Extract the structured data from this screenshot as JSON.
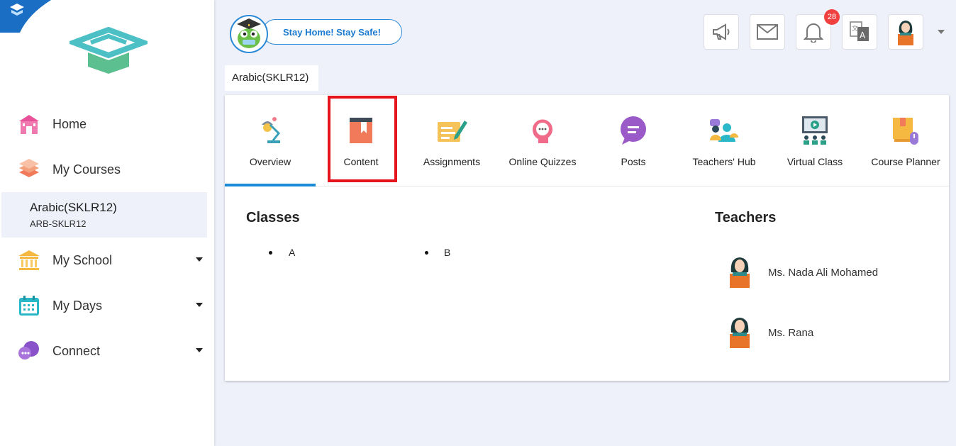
{
  "header": {
    "banner_text": "Stay Home! Stay Safe!",
    "notification_count": "28"
  },
  "sidebar": {
    "items": [
      {
        "label": "Home",
        "icon": "home-icon"
      },
      {
        "label": "My Courses",
        "icon": "courses-icon"
      },
      {
        "label": "My School",
        "icon": "school-icon"
      },
      {
        "label": "My Days",
        "icon": "calendar-icon"
      },
      {
        "label": "Connect",
        "icon": "connect-icon"
      }
    ],
    "active_course": {
      "title": "Arabic(SKLR12)",
      "code": "ARB-SKLR12"
    }
  },
  "course_chip": "Arabic(SKLR12)",
  "tabs": [
    {
      "label": "Overview",
      "icon": "lamp-icon"
    },
    {
      "label": "Content",
      "icon": "book-icon"
    },
    {
      "label": "Assignments",
      "icon": "assignment-icon"
    },
    {
      "label": "Online Quizzes",
      "icon": "quiz-icon"
    },
    {
      "label": "Posts",
      "icon": "chat-icon"
    },
    {
      "label": "Teachers' Hub",
      "icon": "teachers-icon"
    },
    {
      "label": "Virtual Class",
      "icon": "video-class-icon"
    },
    {
      "label": "Course Planner",
      "icon": "planner-icon"
    }
  ],
  "active_tab": "Overview",
  "overview": {
    "classes_heading": "Classes",
    "classes": [
      "A",
      "B"
    ],
    "teachers_heading": "Teachers",
    "teachers": [
      "Ms. Nada Ali Mohamed",
      "Ms. Rana"
    ]
  },
  "colors": {
    "accent": "#1a8bd6",
    "highlight": "#e5141e",
    "badge": "#f04040"
  }
}
